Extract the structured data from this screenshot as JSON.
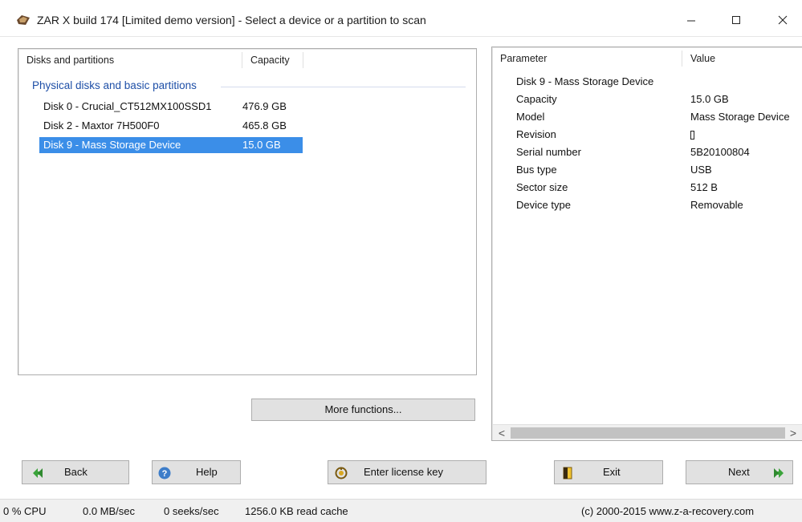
{
  "window": {
    "title": "ZAR X build 174 [Limited demo version] - Select a device or a partition to scan",
    "controls": {
      "minimize": "—",
      "maximize": "☐",
      "close": "✕"
    }
  },
  "disks_panel": {
    "headers": {
      "name": "Disks and partitions",
      "capacity": "Capacity"
    },
    "group_label": "Physical disks and basic partitions",
    "disks": [
      {
        "name": "Disk 0 - Crucial_CT512MX100SSD1",
        "capacity": "476.9 GB",
        "selected": false
      },
      {
        "name": "Disk 2 - Maxtor 7H500F0",
        "capacity": "465.8 GB",
        "selected": false
      },
      {
        "name": "Disk 9 - Mass Storage Device",
        "capacity": "15.0 GB",
        "selected": true
      }
    ],
    "more_button": "More functions..."
  },
  "params_panel": {
    "headers": {
      "parameter": "Parameter",
      "value": "Value"
    },
    "device_title": "Disk 9 - Mass Storage Device",
    "rows": [
      {
        "param": "Capacity",
        "value": "15.0 GB"
      },
      {
        "param": "Model",
        "value": "Mass Storage Device"
      },
      {
        "param": "Revision",
        "value": "\u0000"
      },
      {
        "param": "Serial number",
        "value": "5B20100804"
      },
      {
        "param": "Bus type",
        "value": "USB"
      },
      {
        "param": "Sector size",
        "value": "512 B"
      },
      {
        "param": "Device type",
        "value": "Removable"
      }
    ],
    "scroll": {
      "left": "<",
      "right": ">"
    }
  },
  "buttons": {
    "back": "Back",
    "help": "Help",
    "license": "Enter license key",
    "exit": "Exit",
    "next": "Next"
  },
  "statusbar": {
    "cpu": "0 % CPU",
    "speed": "0.0 MB/sec",
    "seeks": "0 seeks/sec",
    "cache": "1256.0 KB read cache",
    "copyright": "(c) 2000-2015 www.z-a-recovery.com"
  },
  "colors": {
    "selection": "#3b8ee8",
    "group_header": "#1e4fa7",
    "button_face": "#e1e1e1",
    "nav_arrow": "#3aa33a"
  }
}
